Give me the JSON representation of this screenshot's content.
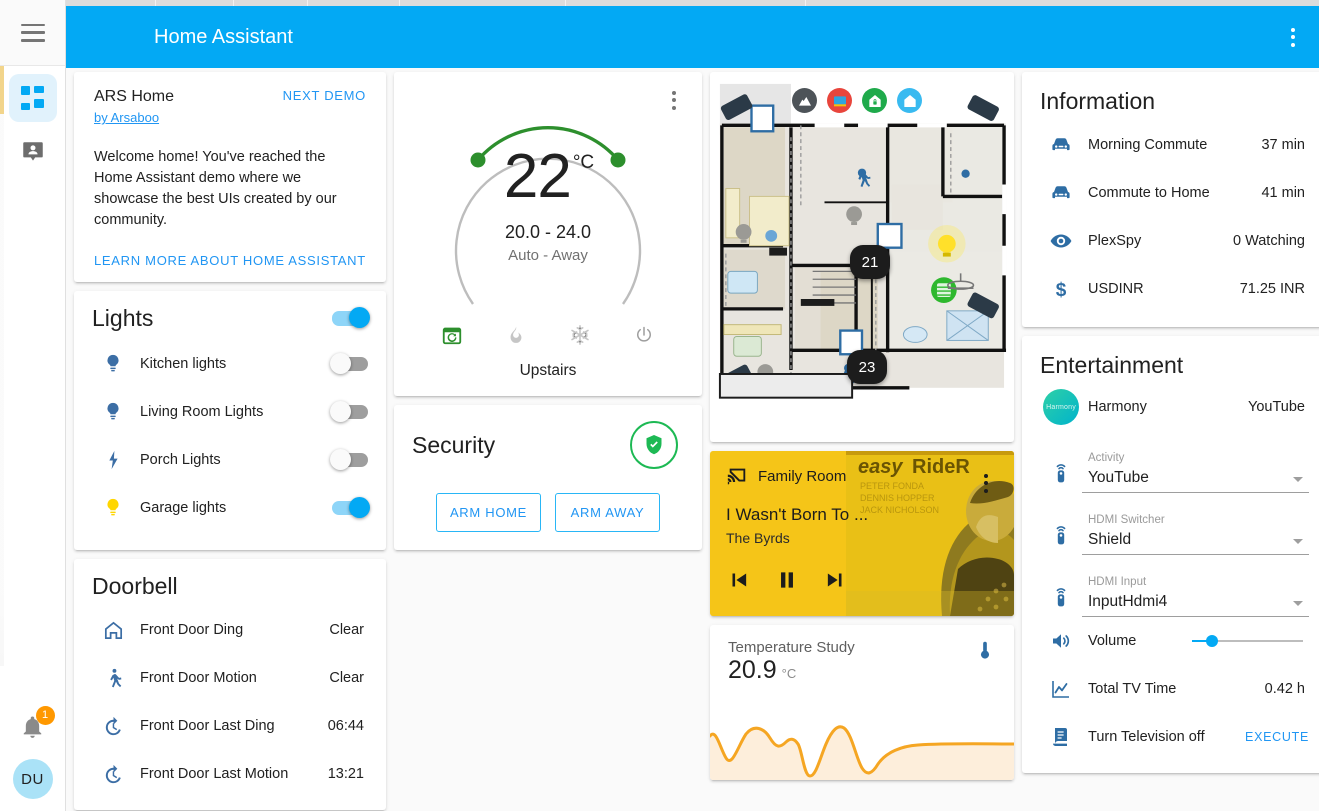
{
  "header": {
    "title": "Home Assistant",
    "menu_icon": "hamburger-icon",
    "overflow_icon": "kebab-menu-icon"
  },
  "sidebar": {
    "items": [
      {
        "name": "overview",
        "icon": "grid-icon",
        "active": true
      },
      {
        "name": "map",
        "icon": "person-pin-icon",
        "active": false
      }
    ],
    "notification_badge": "1",
    "avatar_initials": "DU"
  },
  "welcome": {
    "name": "ARS Home",
    "author": "by Arsaboo",
    "next_demo": "NEXT DEMO",
    "body": "Welcome home! You've reached the Home Assistant demo where we showcase the best UIs created by our community.",
    "learn_more": "LEARN MORE ABOUT HOME ASSISTANT"
  },
  "lights": {
    "title": "Lights",
    "master_on": true,
    "items": [
      {
        "label": "Kitchen lights",
        "icon": "bulb-icon",
        "state": "off",
        "color": "#3c6ea5"
      },
      {
        "label": "Living Room Lights",
        "icon": "bulb-icon",
        "state": "off",
        "color": "#3c6ea5"
      },
      {
        "label": "Porch Lights",
        "icon": "flash-icon",
        "state": "off",
        "color": "#3c6ea5"
      },
      {
        "label": "Garage lights",
        "icon": "bulb-icon",
        "state": "on",
        "color": "#ffd600"
      }
    ]
  },
  "doorbell": {
    "title": "Doorbell",
    "items": [
      {
        "label": "Front Door Ding",
        "value": "Clear",
        "icon": "home-outline-icon"
      },
      {
        "label": "Front Door Motion",
        "value": "Clear",
        "icon": "walk-icon"
      },
      {
        "label": "Front Door Last Ding",
        "value": "06:44",
        "icon": "history-icon"
      },
      {
        "label": "Front Door Last Motion",
        "value": "13:21",
        "icon": "history-icon"
      }
    ]
  },
  "thermostat": {
    "current": "22",
    "unit": "°C",
    "range": "20.0 - 24.0",
    "mode_text": "Auto - Away",
    "name": "Upstairs",
    "active_color": "#2d8f2d",
    "modes": [
      {
        "name": "auto",
        "icon": "calendar-sync-icon",
        "active": true
      },
      {
        "name": "heat",
        "icon": "flame-icon",
        "active": false
      },
      {
        "name": "cool",
        "icon": "snowflake-icon",
        "active": false
      },
      {
        "name": "off",
        "icon": "power-icon",
        "active": false
      }
    ],
    "overflow_icon": "kebab-menu-icon"
  },
  "security": {
    "title": "Security",
    "status_icon": "shield-check-icon",
    "status_color": "#1db954",
    "buttons": [
      {
        "label": "ARM HOME"
      },
      {
        "label": "ARM AWAY"
      }
    ]
  },
  "floorplan": {
    "status_icons": [
      {
        "name": "alarm-mountain-icon",
        "color": "#4d5358"
      },
      {
        "name": "tv-icon",
        "color": "#e8453c"
      },
      {
        "name": "home-lock-icon",
        "color": "#1faa4b"
      },
      {
        "name": "home-icon",
        "color": "#39baf0"
      }
    ],
    "thermostats": [
      {
        "value": "21"
      },
      {
        "value": "23"
      }
    ]
  },
  "media": {
    "source": "Family Room",
    "source_icon": "cast-icon",
    "title": "I Wasn't Born To ...",
    "artist": "The Byrds",
    "art_title": "easy rider",
    "art_credits": [
      "PETER FONDA",
      "DENNIS HOPPER",
      "JACK NICHOLSON"
    ],
    "background": "#f5c518",
    "controls": [
      {
        "name": "previous",
        "icon": "skip-previous-icon"
      },
      {
        "name": "pause",
        "icon": "pause-icon"
      },
      {
        "name": "next",
        "icon": "skip-next-icon"
      }
    ],
    "overflow_icon": "kebab-menu-icon"
  },
  "temperature_study": {
    "label": "Temperature Study",
    "value": "20.9",
    "unit": "°C",
    "icon": "thermometer-icon",
    "line_color": "#f5a623"
  },
  "information": {
    "title": "Information",
    "items": [
      {
        "label": "Morning Commute",
        "value": "37 min",
        "icon": "car-icon"
      },
      {
        "label": "Commute to Home",
        "value": "41 min",
        "icon": "car-icon"
      },
      {
        "label": "PlexSpy",
        "value": "0 Watching",
        "icon": "eye-icon"
      },
      {
        "label": "USDINR",
        "value": "71.25 INR",
        "icon": "dollar-icon"
      }
    ]
  },
  "entertainment": {
    "title": "Entertainment",
    "harmony": {
      "label": "Harmony",
      "value": "YouTube",
      "avatar_text": "Harmony"
    },
    "selects": [
      {
        "label": "Activity",
        "value": "YouTube",
        "icon": "remote-icon"
      },
      {
        "label": "HDMI Switcher",
        "value": "Shield",
        "icon": "remote-icon"
      },
      {
        "label": "HDMI Input",
        "value": "InputHdmi4",
        "icon": "remote-icon"
      }
    ],
    "volume": {
      "label": "Volume",
      "icon": "volume-icon",
      "percent": 18
    },
    "tv_time": {
      "label": "Total TV Time",
      "value": "0.42 h",
      "icon": "chart-line-icon"
    },
    "script": {
      "label": "Turn Television off",
      "action": "EXECUTE",
      "icon": "script-icon"
    }
  },
  "chart_data": {
    "type": "area",
    "title": "Temperature Study",
    "ylabel": "°C",
    "x": [
      0,
      1,
      2,
      3,
      4,
      5,
      6,
      7,
      8,
      9,
      10,
      11,
      12,
      13,
      14,
      15,
      16,
      17,
      18,
      19,
      20,
      21,
      22,
      23
    ],
    "values": [
      21.1,
      20.2,
      20.6,
      21.4,
      21.5,
      21.3,
      20.9,
      21.0,
      20.8,
      20.6,
      20.2,
      19.9,
      20.5,
      21.3,
      21.4,
      21.0,
      20.3,
      20.0,
      20.6,
      20.8,
      20.9,
      20.9,
      20.9,
      20.9
    ],
    "line_color": "#f5a623",
    "fill_color": "#fdeedb",
    "grid": false,
    "legend": "none"
  }
}
